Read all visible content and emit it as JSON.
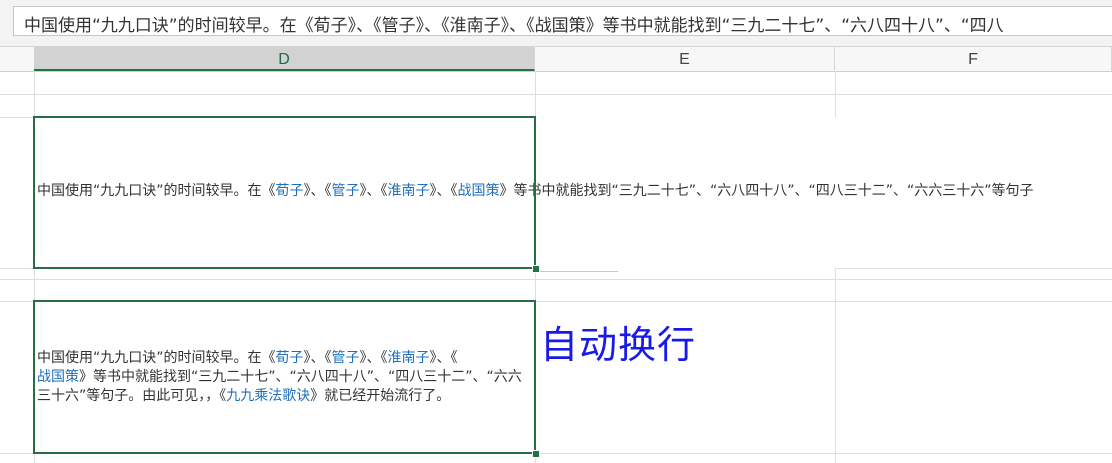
{
  "formula_bar": {
    "text": "中国使用“九九口诀”的时间较早。在《荀子》、《管子》、《淮南子》、《战国策》等书中就能找到“三九二十七”、“六八四十八”、“四八"
  },
  "columns": [
    {
      "label": "D"
    },
    {
      "label": "E"
    },
    {
      "label": "F"
    }
  ],
  "cell_overflow": {
    "parts": [
      {
        "text": "中国使用“九九口诀”的时间较早。在《",
        "link": false
      },
      {
        "text": "荀子",
        "link": true
      },
      {
        "text": "》、《",
        "link": false
      },
      {
        "text": "管子",
        "link": true
      },
      {
        "text": "》、《",
        "link": false
      },
      {
        "text": "淮南子",
        "link": true
      },
      {
        "text": "》、《",
        "link": false
      },
      {
        "text": "战国策",
        "link": true
      },
      {
        "text": "》等书中就能找到“三九二十七”、“六八四十八”、“四八三十二”、“六六三十六”等句子",
        "link": false
      }
    ]
  },
  "cell_wrapped": {
    "lines": [
      [
        {
          "text": "中国使用“九九口诀”的时间较早。在《",
          "link": false
        },
        {
          "text": "荀子",
          "link": true
        },
        {
          "text": "》、《",
          "link": false
        },
        {
          "text": "管子",
          "link": true
        },
        {
          "text": "》、《",
          "link": false
        },
        {
          "text": "淮南子",
          "link": true
        },
        {
          "text": "》、《",
          "link": false
        }
      ],
      [
        {
          "text": "战国策",
          "link": true
        },
        {
          "text": "》等书中就能找到“三九二十七”、“六八四十八”、“四八三十二”、“六六",
          "link": false
        }
      ],
      [
        {
          "text": "三十六”等句子。由此可见，，《",
          "link": false
        },
        {
          "text": "九九乘法歌诀",
          "link": true
        },
        {
          "text": "》就已经开始流行了。",
          "link": false
        }
      ]
    ]
  },
  "annotation": {
    "text": "自动换行",
    "color": "#1a1ae6"
  },
  "colors": {
    "selection": "#217346",
    "link": "#1f6fbd"
  }
}
